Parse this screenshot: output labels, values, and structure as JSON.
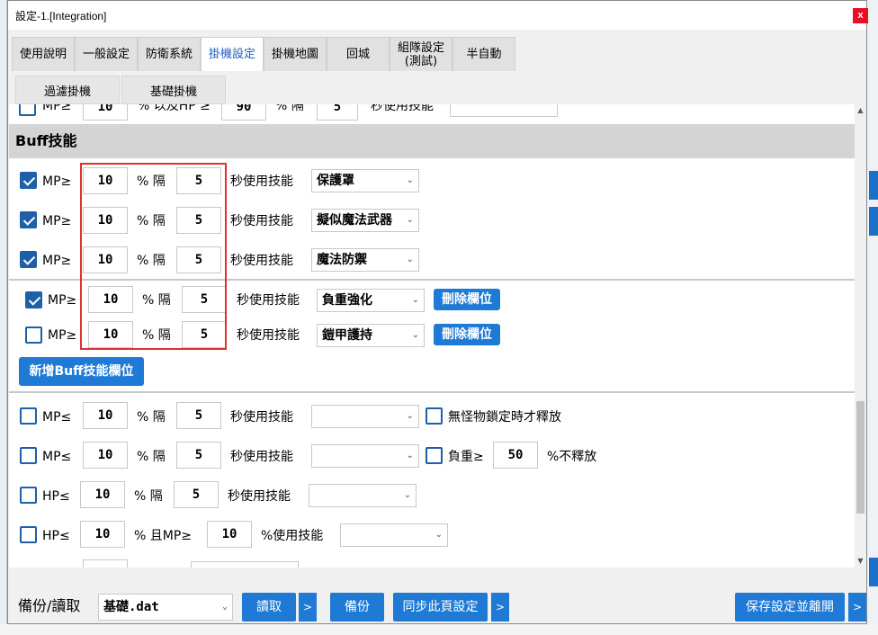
{
  "window": {
    "title": "設定-1.[Integration]",
    "close_label": "x"
  },
  "tabs": [
    {
      "label": "使用說明"
    },
    {
      "label": "一般設定"
    },
    {
      "label": "防衛系統"
    },
    {
      "label": "掛機設定",
      "active": true
    },
    {
      "label": "掛機地圖"
    },
    {
      "label": "回城"
    },
    {
      "label": "組隊設定\n(測試)"
    },
    {
      "label": "半自動"
    }
  ],
  "subtabs": [
    {
      "label": "過濾掛機"
    },
    {
      "label": "基礎掛機"
    }
  ],
  "partial_row": {
    "mp_label": "MP≥",
    "mp_value": "10",
    "mid_label": "% 以及HP ≥",
    "hp_value": "90",
    "pct_label": "% 隔",
    "sec_value": "5",
    "action_label": "秒使用技能"
  },
  "buff_section": {
    "title": "Buff技能",
    "fixed_rows": [
      {
        "checked": true,
        "mp_label": "MP≥",
        "mp_value": "10",
        "interval_label": "% 隔",
        "sec_value": "5",
        "action_label": "秒使用技能",
        "skill": "保護罩"
      },
      {
        "checked": true,
        "mp_label": "MP≥",
        "mp_value": "10",
        "interval_label": "% 隔",
        "sec_value": "5",
        "action_label": "秒使用技能",
        "skill": "擬似魔法武器"
      },
      {
        "checked": true,
        "mp_label": "MP≥",
        "mp_value": "10",
        "interval_label": "% 隔",
        "sec_value": "5",
        "action_label": "秒使用技能",
        "skill": "魔法防禦"
      }
    ],
    "custom_rows": [
      {
        "checked": true,
        "mp_label": "MP≥",
        "mp_value": "10",
        "interval_label": "% 隔",
        "sec_value": "5",
        "action_label": "秒使用技能",
        "skill": "負重強化",
        "delete_label": "刪除欄位"
      },
      {
        "checked": false,
        "mp_label": "MP≥",
        "mp_value": "10",
        "interval_label": "% 隔",
        "sec_value": "5",
        "action_label": "秒使用技能",
        "skill": "鎧甲護持",
        "delete_label": "刪除欄位"
      }
    ],
    "add_label": "新增Buff技能欄位"
  },
  "other_rows": [
    {
      "checked": false,
      "label": "MP≤",
      "value": "10",
      "interval_label": "% 隔",
      "sec_value": "5",
      "action_label": "秒使用技能",
      "skill": "",
      "extra_checked": false,
      "extra_label": "無怪物鎖定時才釋放"
    },
    {
      "checked": false,
      "label": "MP≤",
      "value": "10",
      "interval_label": "% 隔",
      "sec_value": "5",
      "action_label": "秒使用技能",
      "skill": "",
      "extra_checked": false,
      "extra_label": "負重≥",
      "extra_value": "50",
      "extra_suffix": "%不釋放"
    },
    {
      "checked": false,
      "label": "HP≤",
      "value": "10",
      "interval_label": "% 隔",
      "sec_value": "5",
      "action_label": "秒使用技能",
      "skill": ""
    },
    {
      "checked": false,
      "label": "HP≤",
      "value": "10",
      "interval_label": "% 且MP≥",
      "sec_value": "10",
      "action_label": "%使用技能",
      "skill": ""
    }
  ],
  "footer": {
    "backup_label": "備份/讀取",
    "file_value": "基礎.dat",
    "read_label": "讀取",
    "more_label": ">",
    "backup_btn_label": "備份",
    "sync_label": "同步此頁設定",
    "save_label": "保存設定並離開"
  },
  "colors": {
    "accent": "#1f7ad6",
    "checkbox": "#1f5fa8",
    "highlight_box": "#e03030",
    "section_header": "#d4d4d4"
  }
}
